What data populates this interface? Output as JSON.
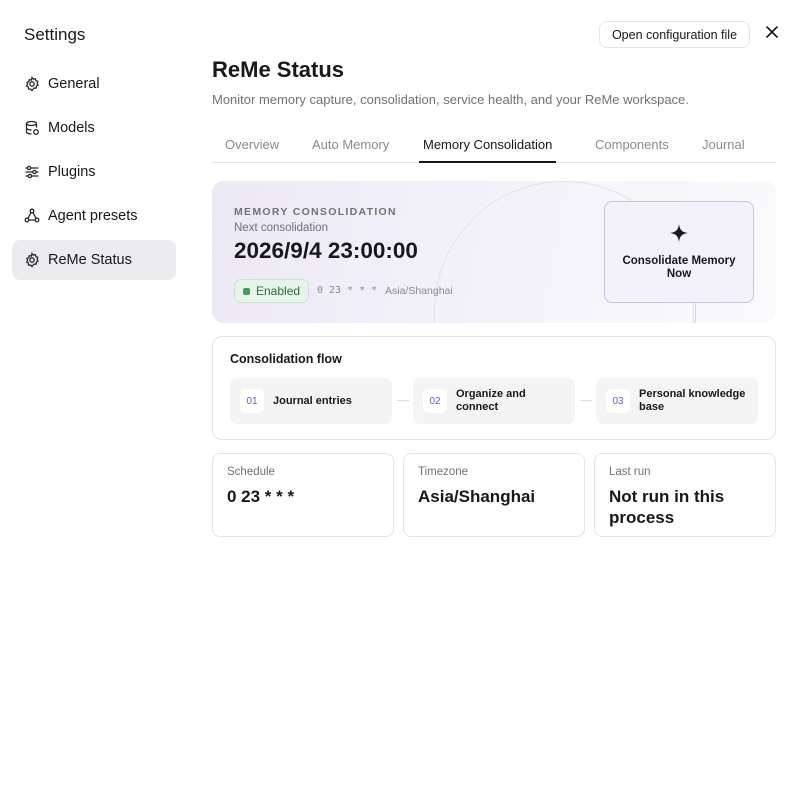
{
  "sidebar": {
    "title": "Settings",
    "items": [
      {
        "label": "General",
        "icon": "gear-icon"
      },
      {
        "label": "Models",
        "icon": "database-icon"
      },
      {
        "label": "Plugins",
        "icon": "sliders-icon"
      },
      {
        "label": "Agent presets",
        "icon": "nodes-icon"
      },
      {
        "label": "ReMe Status",
        "icon": "gear-icon",
        "active": true
      }
    ]
  },
  "header": {
    "open_config_label": "Open configuration file",
    "close_icon": "close-icon"
  },
  "main": {
    "title": "ReMe Status",
    "subtitle": "Monitor memory capture, consolidation, service health, and your ReMe workspace.",
    "tabs": [
      {
        "label": "Overview"
      },
      {
        "label": "Auto Memory"
      },
      {
        "label": "Memory Consolidation",
        "active": true
      },
      {
        "label": "Components"
      },
      {
        "label": "Journal"
      }
    ]
  },
  "hero": {
    "label": "MEMORY CONSOLIDATION",
    "next_label": "Next consolidation",
    "next_date": "2026/9/4 23:00:00",
    "status": "Enabled",
    "cron": "0 23 * * *",
    "timezone": "Asia/Shanghai",
    "button_label": "Consolidate Memory Now",
    "button_icon": "sparkle-icon"
  },
  "flow": {
    "title": "Consolidation flow",
    "steps": [
      {
        "num": "01",
        "label": "Journal entries"
      },
      {
        "num": "02",
        "label": "Organize and connect"
      },
      {
        "num": "03",
        "label": "Personal knowledge base"
      }
    ]
  },
  "stats": [
    {
      "key": "Schedule",
      "value": "0 23 * * *"
    },
    {
      "key": "Timezone",
      "value": "Asia/Shanghai"
    },
    {
      "key": "Last run",
      "value": "Not run in this process"
    }
  ],
  "colors": {
    "accent": "#6b5fb5",
    "active_nav_bg": "#ececee",
    "status_green": "#4a9a5f"
  }
}
